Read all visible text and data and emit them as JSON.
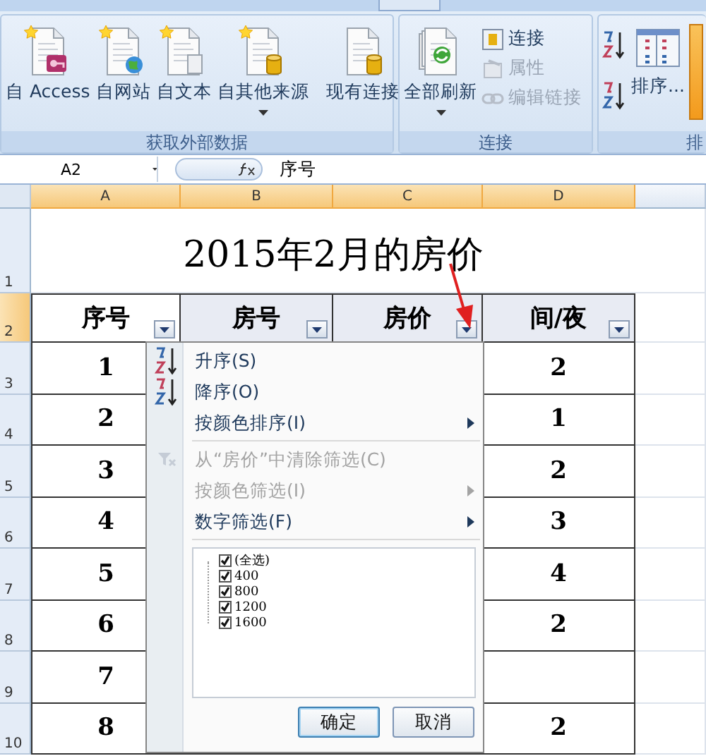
{
  "ribbon": {
    "groups": [
      {
        "label": "获取外部数据",
        "kind": "import",
        "large_buttons": [
          {
            "label": "自 Access",
            "kind": "access",
            "dropdown": false
          },
          {
            "label": "自网站",
            "kind": "web",
            "dropdown": false
          },
          {
            "label": "自文本",
            "kind": "text",
            "dropdown": false
          },
          {
            "label": "自其他来源",
            "kind": "other",
            "dropdown": true
          },
          {
            "label": "现有连接",
            "kind": "existing",
            "dropdown": false
          }
        ]
      },
      {
        "label": "连接",
        "kind": "connections",
        "large_buttons": [
          {
            "label": "全部刷新",
            "kind": "refresh",
            "dropdown": true
          }
        ],
        "small_buttons": [
          {
            "label": "连接",
            "kind": "connection",
            "disabled": false
          },
          {
            "label": "属性",
            "kind": "properties",
            "disabled": true
          },
          {
            "label": "编辑链接",
            "kind": "links",
            "disabled": true
          }
        ]
      },
      {
        "label": "排",
        "kind": "sort",
        "large_buttons": [
          {
            "label": "排序...",
            "kind": "sort",
            "dropdown": false
          }
        ]
      }
    ]
  },
  "formula_bar": {
    "name_box": "A2",
    "formula": "序号"
  },
  "sheet": {
    "columns": [
      {
        "label": "A",
        "selected": true
      },
      {
        "label": "B",
        "selected": true
      },
      {
        "label": "C",
        "selected": true
      },
      {
        "label": "D",
        "selected": true
      }
    ],
    "rows": [
      {
        "label": "1",
        "selected": false
      },
      {
        "label": "2",
        "selected": true
      },
      {
        "label": "3",
        "selected": false
      },
      {
        "label": "4",
        "selected": false
      },
      {
        "label": "5",
        "selected": false
      },
      {
        "label": "6",
        "selected": false
      },
      {
        "label": "7",
        "selected": false
      },
      {
        "label": "8",
        "selected": false
      },
      {
        "label": "9",
        "selected": false
      },
      {
        "label": "10",
        "selected": false
      }
    ],
    "title": "2015年2月的房价",
    "headers": [
      "序号",
      "房号",
      "房价",
      "间/夜"
    ],
    "data_rows": [
      {
        "a": "1",
        "d": "2"
      },
      {
        "a": "2",
        "d": "1"
      },
      {
        "a": "3",
        "d": "2"
      },
      {
        "a": "4",
        "d": "3"
      },
      {
        "a": "5",
        "d": "4"
      },
      {
        "a": "6",
        "d": "2"
      },
      {
        "a": "7"
      },
      {
        "a": "8",
        "d": "2"
      }
    ]
  },
  "filter_menu": {
    "items": [
      {
        "label": "升序(S)",
        "kind": "sort-asc",
        "disabled": false,
        "submenu": false
      },
      {
        "label": "降序(O)",
        "kind": "sort-desc",
        "disabled": false,
        "submenu": false
      },
      {
        "label": "按颜色排序(I)",
        "kind": "plain",
        "disabled": false,
        "submenu": true
      },
      {
        "label": "从“房价”中清除筛选(C)",
        "kind": "clear",
        "disabled": true,
        "submenu": false
      },
      {
        "label": "按颜色筛选(I)",
        "kind": "plain",
        "disabled": true,
        "submenu": true
      },
      {
        "label": "数字筛选(F)",
        "kind": "plain",
        "disabled": false,
        "submenu": true
      }
    ],
    "values": [
      {
        "label": "(全选)",
        "checked": true
      },
      {
        "label": "400",
        "checked": true
      },
      {
        "label": "800",
        "checked": true
      },
      {
        "label": "1200",
        "checked": true
      },
      {
        "label": "1600",
        "checked": true
      }
    ],
    "buttons": [
      "确定",
      "取消"
    ]
  }
}
